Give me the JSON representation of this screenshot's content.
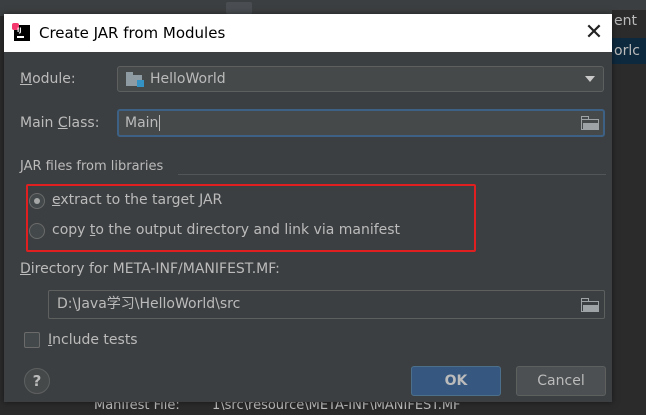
{
  "background": {
    "top_right_1": "ent",
    "top_right_2": "orlc",
    "bottom_label": "Manifest File:",
    "bottom_value": "1\\src\\resource\\META-INF\\MANIFEST.MF"
  },
  "dialog": {
    "title": "Create JAR from Modules",
    "close_label": "✕"
  },
  "module": {
    "label_mnemonic": "M",
    "label_rest": "odule:",
    "value": "HelloWorld"
  },
  "main_class": {
    "label_pre": "Main ",
    "label_mnemonic": "C",
    "label_rest": "lass:",
    "value": "Main"
  },
  "jar_files": {
    "section_label": "JAR files from libraries",
    "option_extract_mnemonic": "e",
    "option_extract_rest": "xtract to the target JAR",
    "option_copy_pre": "copy ",
    "option_copy_mnemonic": "t",
    "option_copy_rest": "o the output directory and link via manifest",
    "selected": "extract"
  },
  "directory": {
    "label_mnemonic": "D",
    "label_rest": "irectory for META-INF/MANIFEST.MF:",
    "value": "D:\\Java学习\\HelloWorld\\src"
  },
  "include_tests": {
    "label_mnemonic": "I",
    "label_rest": "nclude tests",
    "checked": false
  },
  "buttons": {
    "help": "?",
    "ok": "OK",
    "cancel": "Cancel"
  },
  "colors": {
    "dialog_bg": "#3c3f41",
    "text": "#bbbbbb",
    "ok_button": "#365880",
    "highlight": "#e02020"
  }
}
